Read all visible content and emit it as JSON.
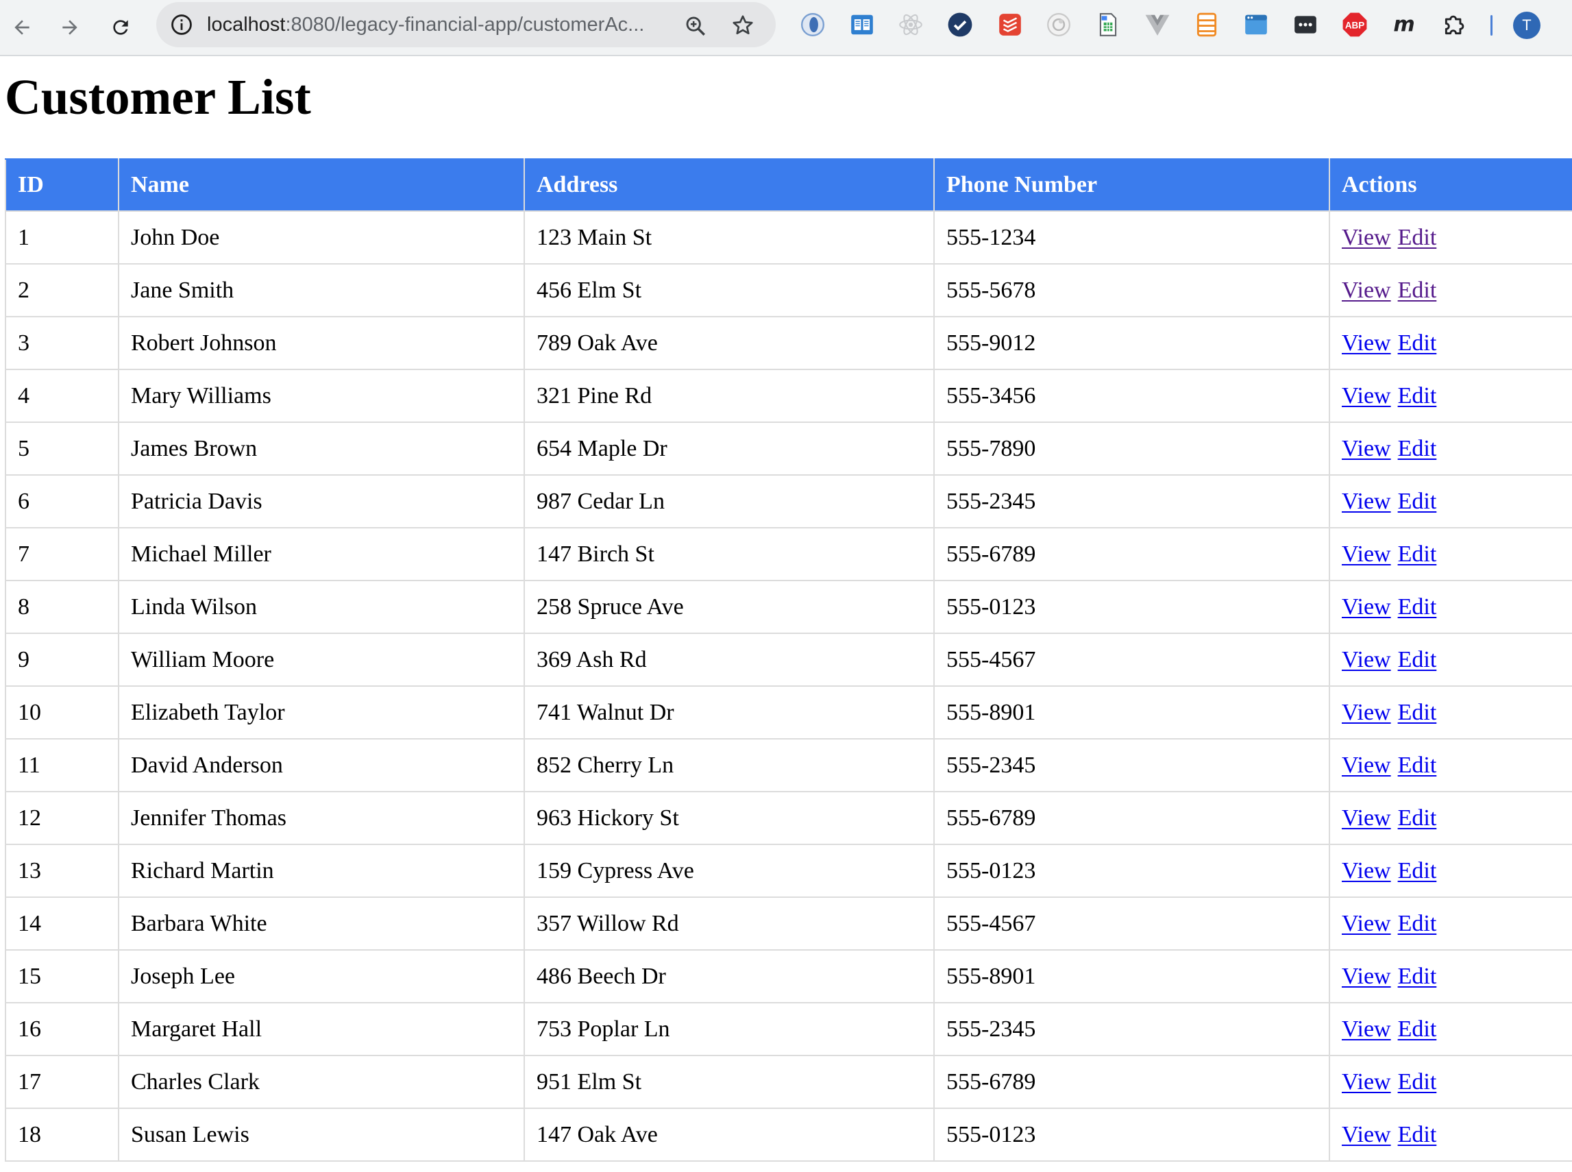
{
  "browser": {
    "url_host": "localhost",
    "url_path": ":8080/legacy-financial-app/customerAc...",
    "avatar_letter": "T",
    "extensions": [
      "ext-blue-circle-icon",
      "reader-book-icon",
      "react-devtools-icon",
      "checkmark-circle-icon",
      "todoist-icon",
      "privacy-badger-icon",
      "document-sheet-icon",
      "vue-devtools-icon",
      "orange-stack-icon",
      "window-preview-icon",
      "ellipsis-box-icon",
      "adblock-plus-icon",
      "m-letter-icon",
      "extensions-puzzle-icon"
    ]
  },
  "page": {
    "title": "Customer List"
  },
  "table": {
    "headers": [
      "ID",
      "Name",
      "Address",
      "Phone Number",
      "Actions"
    ],
    "view_label": "View",
    "edit_label": "Edit",
    "colors": {
      "header_bg": "#3b7ced",
      "link": "#0000ee",
      "visited_link": "#551a8b"
    },
    "rows": [
      {
        "id": "1",
        "name": "John Doe",
        "address": "123 Main St",
        "phone": "555-1234",
        "view_visited": true,
        "edit_visited": true
      },
      {
        "id": "2",
        "name": "Jane Smith",
        "address": "456 Elm St",
        "phone": "555-5678",
        "view_visited": true,
        "edit_visited": true
      },
      {
        "id": "3",
        "name": "Robert Johnson",
        "address": "789 Oak Ave",
        "phone": "555-9012",
        "view_visited": false,
        "edit_visited": false
      },
      {
        "id": "4",
        "name": "Mary Williams",
        "address": "321 Pine Rd",
        "phone": "555-3456",
        "view_visited": false,
        "edit_visited": false
      },
      {
        "id": "5",
        "name": "James Brown",
        "address": "654 Maple Dr",
        "phone": "555-7890",
        "view_visited": false,
        "edit_visited": false
      },
      {
        "id": "6",
        "name": "Patricia Davis",
        "address": "987 Cedar Ln",
        "phone": "555-2345",
        "view_visited": false,
        "edit_visited": false
      },
      {
        "id": "7",
        "name": "Michael Miller",
        "address": "147 Birch St",
        "phone": "555-6789",
        "view_visited": false,
        "edit_visited": false
      },
      {
        "id": "8",
        "name": "Linda Wilson",
        "address": "258 Spruce Ave",
        "phone": "555-0123",
        "view_visited": false,
        "edit_visited": false
      },
      {
        "id": "9",
        "name": "William Moore",
        "address": "369 Ash Rd",
        "phone": "555-4567",
        "view_visited": false,
        "edit_visited": false
      },
      {
        "id": "10",
        "name": "Elizabeth Taylor",
        "address": "741 Walnut Dr",
        "phone": "555-8901",
        "view_visited": false,
        "edit_visited": false
      },
      {
        "id": "11",
        "name": "David Anderson",
        "address": "852 Cherry Ln",
        "phone": "555-2345",
        "view_visited": false,
        "edit_visited": false
      },
      {
        "id": "12",
        "name": "Jennifer Thomas",
        "address": "963 Hickory St",
        "phone": "555-6789",
        "view_visited": false,
        "edit_visited": false
      },
      {
        "id": "13",
        "name": "Richard Martin",
        "address": "159 Cypress Ave",
        "phone": "555-0123",
        "view_visited": false,
        "edit_visited": false
      },
      {
        "id": "14",
        "name": "Barbara White",
        "address": "357 Willow Rd",
        "phone": "555-4567",
        "view_visited": false,
        "edit_visited": false
      },
      {
        "id": "15",
        "name": "Joseph Lee",
        "address": "486 Beech Dr",
        "phone": "555-8901",
        "view_visited": false,
        "edit_visited": false
      },
      {
        "id": "16",
        "name": "Margaret Hall",
        "address": "753 Poplar Ln",
        "phone": "555-2345",
        "view_visited": false,
        "edit_visited": false
      },
      {
        "id": "17",
        "name": "Charles Clark",
        "address": "951 Elm St",
        "phone": "555-6789",
        "view_visited": false,
        "edit_visited": false
      },
      {
        "id": "18",
        "name": "Susan Lewis",
        "address": "147 Oak Ave",
        "phone": "555-0123",
        "view_visited": false,
        "edit_visited": false
      }
    ]
  }
}
